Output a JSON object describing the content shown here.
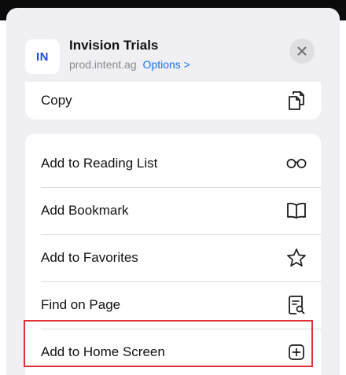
{
  "header": {
    "logo_text": "IN",
    "title": "Invision Trials",
    "domain": "prod.intent.ag",
    "options_label": "Options >",
    "close_icon": "close-icon"
  },
  "card1": {
    "items": [
      {
        "label": "Copy",
        "icon": "copy-icon"
      }
    ]
  },
  "card2": {
    "items": [
      {
        "label": "Add to Reading List",
        "icon": "glasses-icon"
      },
      {
        "label": "Add Bookmark",
        "icon": "book-icon"
      },
      {
        "label": "Add to Favorites",
        "icon": "star-icon"
      },
      {
        "label": "Find on Page",
        "icon": "find-doc-icon"
      },
      {
        "label": "Add to Home Screen",
        "icon": "plus-square-icon"
      }
    ]
  },
  "colors": {
    "accent": "#1a73e8",
    "logo": "#1f4fd1",
    "highlight": "#e0303a",
    "sheet_bg": "#efeff4"
  }
}
